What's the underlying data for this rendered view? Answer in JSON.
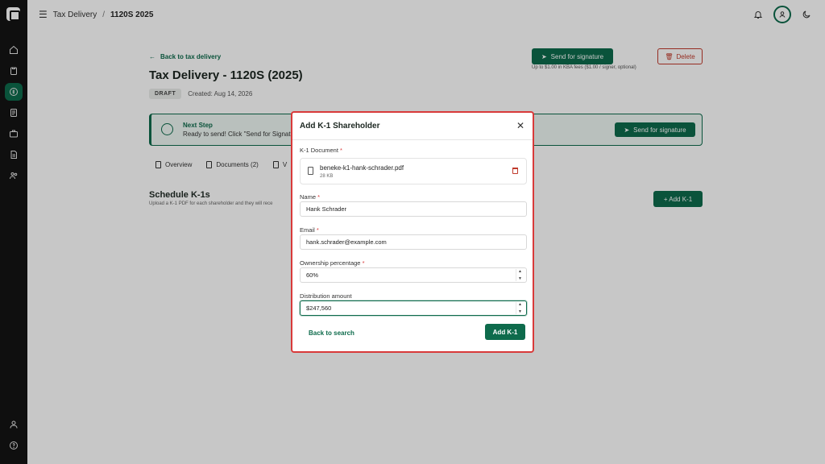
{
  "breadcrumb": {
    "menu_icon": "hamburger-icon",
    "parent": "Tax Delivery",
    "separator": "/",
    "current": "1120S 2025"
  },
  "rail": {
    "icons": [
      "home-icon",
      "clipboard-icon",
      "dollar-circle-icon",
      "document-icon",
      "briefcase-icon",
      "file-text-icon",
      "users-icon",
      "user-icon",
      "help-icon"
    ],
    "active": "dollar-circle-icon"
  },
  "topbar": {
    "icons": [
      "bell-icon",
      "account-icon",
      "moon-icon"
    ]
  },
  "page": {
    "back_link": "Back to tax delivery",
    "title": "Tax Delivery - 1120S (2025)",
    "status_badge": "DRAFT",
    "created": "Created: Aug 14, 2026",
    "send_button": "Send for signature",
    "delete_button": "Delete",
    "kba_note": "Up to $1.00 in KBA fees ($1.00 / signer, optional)"
  },
  "next_step": {
    "title": "Next Step",
    "description": "Ready to send! Click \"Send for Signat",
    "button": "Send for signature"
  },
  "tabs": [
    {
      "label": "Overview"
    },
    {
      "label": "Documents (2)"
    },
    {
      "label": "V"
    }
  ],
  "section": {
    "title": "Schedule K-1s",
    "description": "Upload a K-1 PDF for each shareholder and they will rece",
    "add_button": "+ Add K-1"
  },
  "modal": {
    "title": "Add K-1 Shareholder",
    "close_icon": "close-icon",
    "k1_document_label": "K-1 Document",
    "file_name": "beneke-k1-hank-schrader.pdf",
    "file_size": "28 KB",
    "name_label": "Name",
    "name_value": "Hank Schrader",
    "email_label": "Email",
    "email_value": "hank.schrader@example.com",
    "ownership_label": "Ownership percentage",
    "ownership_value": "60%",
    "distribution_label": "Distribution amount",
    "distribution_value": "$247,560",
    "required_mark": "*",
    "back_button": "Back to search",
    "submit_button": "Add K-1"
  },
  "colors": {
    "accent": "#0e6b4c",
    "danger": "#c0392b",
    "modal_border": "#d93a3a"
  }
}
